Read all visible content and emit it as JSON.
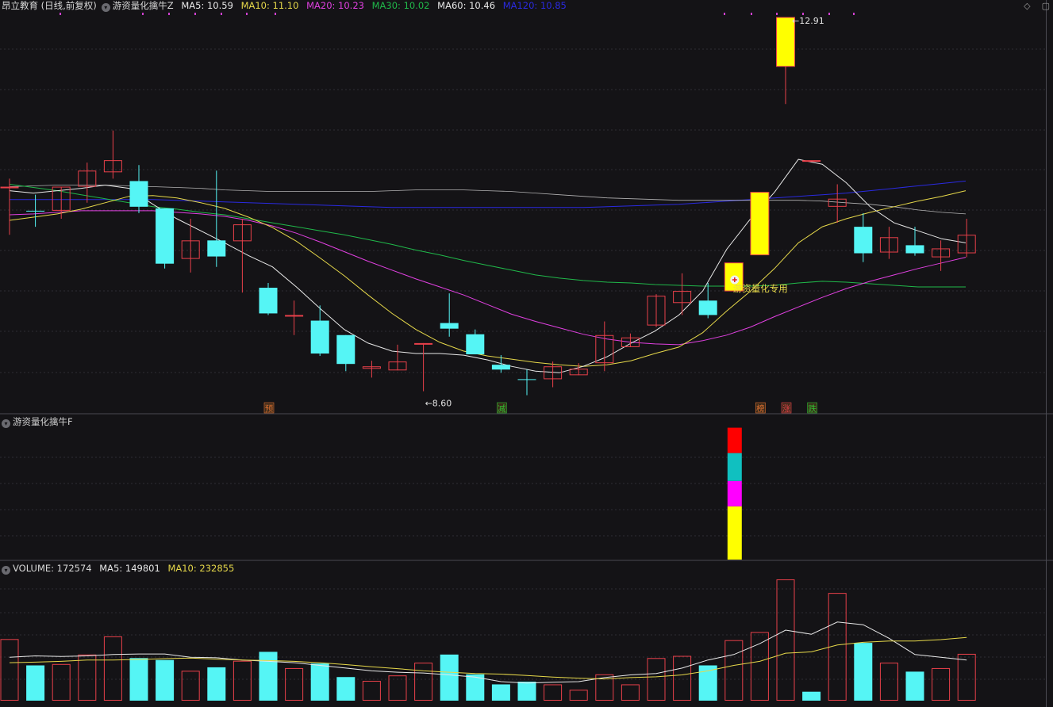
{
  "header": {
    "stock": "昂立教育 (日线,前复权)",
    "indicator": "游资量化擒牛Z",
    "ma": [
      {
        "label": "MA5: 10.59",
        "color": "#e8e8e8"
      },
      {
        "label": "MA10: 11.10",
        "color": "#e6d84a"
      },
      {
        "label": "MA20: 10.23",
        "color": "#e040e0"
      },
      {
        "label": "MA30: 10.02",
        "color": "#20b84a"
      },
      {
        "label": "MA60: 10.46",
        "color": "#e8e8e8"
      },
      {
        "label": "MA120: 10.85",
        "color": "#2a2ae0"
      }
    ]
  },
  "sub_panel_title": "游资量化擒牛F",
  "volume_header": {
    "volume": "VOLUME: 172574",
    "ma5": "MA5: 149801",
    "ma10": "MA10: 232855"
  },
  "colors": {
    "up": "#e8404a",
    "down": "#55f5f5",
    "limit_up": "#ffff00",
    "ma5": "#e8e8e8",
    "ma10": "#e6d84a",
    "ma20": "#e040e0",
    "ma30": "#20b84a",
    "ma60": "#e8e8e8",
    "ma120": "#2a2ae0"
  },
  "chart_data": [
    {
      "type": "candlestick",
      "title": "昂立教育 (日线,前复权)",
      "ylim": [
        8.0,
        13.0
      ],
      "annotations": {
        "high_label": "12.91",
        "low_label": "8.60",
        "signal_label": "游资量化专用",
        "markers": [
          {
            "text": "预",
            "index": 10,
            "color": "#e07030"
          },
          {
            "text": "减",
            "index": 19,
            "color": "#30c030"
          },
          {
            "text": "榜",
            "index": 29,
            "color": "#e07030"
          },
          {
            "text": "涨",
            "index": 30,
            "color": "#e8404a"
          },
          {
            "text": "跌",
            "index": 31,
            "color": "#30c030"
          }
        ]
      },
      "candles": [
        {
          "o": 10.8,
          "c": 10.8,
          "h": 10.9,
          "l": 10.2,
          "kind": "up"
        },
        {
          "o": 10.5,
          "c": 10.5,
          "h": 10.7,
          "l": 10.3,
          "kind": "down"
        },
        {
          "o": 10.5,
          "c": 10.8,
          "h": 10.8,
          "l": 10.4,
          "kind": "up"
        },
        {
          "o": 10.8,
          "c": 11.0,
          "h": 11.1,
          "l": 10.6,
          "kind": "up"
        },
        {
          "o": 10.98,
          "c": 11.13,
          "h": 11.5,
          "l": 10.9,
          "kind": "up"
        },
        {
          "o": 10.87,
          "c": 10.55,
          "h": 11.07,
          "l": 10.47,
          "kind": "down"
        },
        {
          "o": 10.53,
          "c": 9.84,
          "h": 10.53,
          "l": 9.78,
          "kind": "down"
        },
        {
          "o": 9.9,
          "c": 10.13,
          "h": 10.4,
          "l": 9.73,
          "kind": "up"
        },
        {
          "o": 10.13,
          "c": 9.93,
          "h": 11.0,
          "l": 9.8,
          "kind": "down"
        },
        {
          "o": 10.12,
          "c": 10.33,
          "h": 10.4,
          "l": 9.48,
          "kind": "up"
        },
        {
          "o": 9.54,
          "c": 9.22,
          "h": 9.6,
          "l": 9.2,
          "kind": "down"
        },
        {
          "o": 9.2,
          "c": 9.2,
          "h": 9.38,
          "l": 8.95,
          "kind": "up"
        },
        {
          "o": 9.13,
          "c": 8.72,
          "h": 9.32,
          "l": 8.69,
          "kind": "down"
        },
        {
          "o": 8.95,
          "c": 8.59,
          "h": 8.95,
          "l": 8.5,
          "kind": "down"
        },
        {
          "o": 8.53,
          "c": 8.56,
          "h": 8.63,
          "l": 8.42,
          "kind": "up"
        },
        {
          "o": 8.51,
          "c": 8.62,
          "h": 8.83,
          "l": 8.51,
          "kind": "up"
        },
        {
          "o": 8.85,
          "c": 8.85,
          "h": 8.85,
          "l": 8.25,
          "kind": "up"
        },
        {
          "o": 9.1,
          "c": 9.03,
          "h": 9.47,
          "l": 8.93,
          "kind": "down"
        },
        {
          "o": 8.96,
          "c": 8.71,
          "h": 9.02,
          "l": 8.71,
          "kind": "down"
        },
        {
          "o": 8.58,
          "c": 8.52,
          "h": 8.7,
          "l": 8.48,
          "kind": "down"
        },
        {
          "o": 8.4,
          "c": 8.4,
          "h": 8.52,
          "l": 8.2,
          "kind": "down"
        },
        {
          "o": 8.4,
          "c": 8.56,
          "h": 8.62,
          "l": 8.3,
          "kind": "up"
        },
        {
          "o": 8.45,
          "c": 8.53,
          "h": 8.6,
          "l": 8.45,
          "kind": "up"
        },
        {
          "o": 8.6,
          "c": 8.95,
          "h": 9.12,
          "l": 8.5,
          "kind": "up"
        },
        {
          "o": 8.8,
          "c": 8.92,
          "h": 8.97,
          "l": 8.8,
          "kind": "up"
        },
        {
          "o": 9.07,
          "c": 9.44,
          "h": 9.46,
          "l": 9.05,
          "kind": "up"
        },
        {
          "o": 9.35,
          "c": 9.5,
          "h": 9.72,
          "l": 9.2,
          "kind": "up"
        },
        {
          "o": 9.38,
          "c": 9.2,
          "h": 9.6,
          "l": 9.16,
          "kind": "down"
        },
        {
          "o": 9.5,
          "c": 9.85,
          "h": 9.85,
          "l": 9.5,
          "kind": "limit"
        },
        {
          "o": 9.95,
          "c": 10.73,
          "h": 10.73,
          "l": 9.95,
          "kind": "limit"
        },
        {
          "o": 12.3,
          "c": 12.91,
          "h": 12.91,
          "l": 11.83,
          "kind": "limit"
        },
        {
          "o": 11.13,
          "c": 11.13,
          "h": 11.13,
          "l": 11.13,
          "kind": "up"
        },
        {
          "o": 10.55,
          "c": 10.65,
          "h": 10.83,
          "l": 10.35,
          "kind": "up"
        },
        {
          "o": 10.3,
          "c": 9.97,
          "h": 10.47,
          "l": 9.86,
          "kind": "down"
        },
        {
          "o": 9.98,
          "c": 10.17,
          "h": 10.3,
          "l": 9.9,
          "kind": "up"
        },
        {
          "o": 10.07,
          "c": 9.97,
          "h": 10.3,
          "l": 9.94,
          "kind": "down"
        },
        {
          "o": 9.92,
          "c": 10.03,
          "h": 10.13,
          "l": 9.75,
          "kind": "up"
        },
        {
          "o": 9.97,
          "c": 10.2,
          "h": 10.4,
          "l": 9.92,
          "kind": "up"
        }
      ],
      "ma5": [
        10.75,
        10.72,
        10.75,
        10.78,
        10.82,
        10.78,
        10.58,
        10.4,
        10.25,
        10.1,
        9.94,
        9.8,
        9.55,
        9.28,
        9.02,
        8.85,
        8.75,
        8.72,
        8.72,
        8.7,
        8.64,
        8.56,
        8.5,
        8.48,
        8.56,
        8.68,
        8.85,
        9.0,
        9.2,
        9.5,
        10.02,
        10.4,
        10.73,
        11.14,
        11.08,
        10.85,
        10.55,
        10.35,
        10.25,
        10.15,
        10.1
      ],
      "ma10": [
        10.38,
        10.42,
        10.46,
        10.52,
        10.6,
        10.68,
        10.69,
        10.66,
        10.6,
        10.53,
        10.42,
        10.29,
        10.12,
        9.91,
        9.69,
        9.45,
        9.22,
        9.02,
        8.86,
        8.75,
        8.69,
        8.65,
        8.61,
        8.58,
        8.56,
        8.58,
        8.63,
        8.72,
        8.8,
        8.98,
        9.25,
        9.5,
        9.78,
        10.1,
        10.3,
        10.4,
        10.48,
        10.55,
        10.62,
        10.68,
        10.75
      ],
      "ma20": [
        10.45,
        10.46,
        10.48,
        10.5,
        10.5,
        10.5,
        10.5,
        10.48,
        10.46,
        10.43,
        10.38,
        10.31,
        10.22,
        10.11,
        9.99,
        9.87,
        9.76,
        9.65,
        9.55,
        9.45,
        9.33,
        9.21,
        9.12,
        9.04,
        8.96,
        8.9,
        8.86,
        8.84,
        8.83,
        8.88,
        8.95,
        9.05,
        9.18,
        9.3,
        9.42,
        9.53,
        9.62,
        9.7,
        9.78,
        9.85,
        9.92
      ],
      "ma30": [
        10.83,
        10.79,
        10.75,
        10.7,
        10.65,
        10.6,
        10.55,
        10.52,
        10.48,
        10.45,
        10.4,
        10.35,
        10.3,
        10.25,
        10.2,
        10.14,
        10.08,
        10.01,
        9.95,
        9.88,
        9.82,
        9.76,
        9.7,
        9.66,
        9.63,
        9.61,
        9.6,
        9.58,
        9.57,
        9.56,
        9.56,
        9.56,
        9.57,
        9.6,
        9.62,
        9.61,
        9.59,
        9.57,
        9.55,
        9.55,
        9.55
      ],
      "ma60": [
        10.8,
        10.81,
        10.82,
        10.82,
        10.82,
        10.81,
        10.8,
        10.79,
        10.78,
        10.76,
        10.75,
        10.74,
        10.74,
        10.74,
        10.74,
        10.74,
        10.75,
        10.76,
        10.76,
        10.76,
        10.75,
        10.74,
        10.72,
        10.7,
        10.68,
        10.66,
        10.65,
        10.64,
        10.63,
        10.63,
        10.63,
        10.63,
        10.63,
        10.63,
        10.62,
        10.6,
        10.58,
        10.55,
        10.51,
        10.48,
        10.46
      ],
      "ma120": [
        10.64,
        10.64,
        10.64,
        10.64,
        10.64,
        10.64,
        10.64,
        10.63,
        10.62,
        10.61,
        10.6,
        10.59,
        10.58,
        10.57,
        10.56,
        10.55,
        10.54,
        10.54,
        10.54,
        10.54,
        10.54,
        10.54,
        10.54,
        10.54,
        10.54,
        10.55,
        10.56,
        10.57,
        10.58,
        10.6,
        10.62,
        10.64,
        10.66,
        10.68,
        10.7,
        10.72,
        10.75,
        10.78,
        10.81,
        10.84,
        10.87
      ]
    },
    {
      "type": "bar",
      "title": "游资量化擒牛F",
      "signal_index": 28,
      "segments": [
        {
          "color": "#ff0000",
          "value": 1.0
        },
        {
          "color": "#10c0c0",
          "value": 1.1
        },
        {
          "color": "#ff00ff",
          "value": 1.0
        },
        {
          "color": "#ffff00",
          "value": 2.1
        }
      ]
    },
    {
      "type": "bar",
      "title": "VOLUME",
      "ylim": [
        0,
        450000
      ],
      "bars": [
        {
          "v": 227000,
          "kind": "up"
        },
        {
          "v": 130000,
          "kind": "down"
        },
        {
          "v": 135000,
          "kind": "up"
        },
        {
          "v": 170000,
          "kind": "up"
        },
        {
          "v": 237000,
          "kind": "up"
        },
        {
          "v": 157000,
          "kind": "down"
        },
        {
          "v": 150000,
          "kind": "down"
        },
        {
          "v": 110000,
          "kind": "up"
        },
        {
          "v": 123000,
          "kind": "down"
        },
        {
          "v": 147000,
          "kind": "up"
        },
        {
          "v": 180000,
          "kind": "down"
        },
        {
          "v": 120000,
          "kind": "up"
        },
        {
          "v": 137000,
          "kind": "down"
        },
        {
          "v": 87000,
          "kind": "down"
        },
        {
          "v": 73000,
          "kind": "up"
        },
        {
          "v": 93000,
          "kind": "up"
        },
        {
          "v": 140000,
          "kind": "up"
        },
        {
          "v": 170000,
          "kind": "down"
        },
        {
          "v": 97000,
          "kind": "down"
        },
        {
          "v": 60000,
          "kind": "down"
        },
        {
          "v": 70000,
          "kind": "down"
        },
        {
          "v": 60000,
          "kind": "up"
        },
        {
          "v": 40000,
          "kind": "up"
        },
        {
          "v": 97000,
          "kind": "up"
        },
        {
          "v": 60000,
          "kind": "up"
        },
        {
          "v": 157000,
          "kind": "up"
        },
        {
          "v": 165000,
          "kind": "up"
        },
        {
          "v": 130000,
          "kind": "down"
        },
        {
          "v": 223000,
          "kind": "up"
        },
        {
          "v": 253000,
          "kind": "up"
        },
        {
          "v": 447000,
          "kind": "up"
        },
        {
          "v": 33000,
          "kind": "down"
        },
        {
          "v": 397000,
          "kind": "up"
        },
        {
          "v": 213000,
          "kind": "down"
        },
        {
          "v": 140000,
          "kind": "up"
        },
        {
          "v": 107000,
          "kind": "down"
        },
        {
          "v": 120000,
          "kind": "up"
        },
        {
          "v": 172574,
          "kind": "up"
        }
      ],
      "ma5_line": [
        160000,
        165000,
        163000,
        165000,
        170000,
        172000,
        172000,
        160000,
        158000,
        150000,
        145000,
        140000,
        130000,
        120000,
        110000,
        105000,
        102000,
        95000,
        87000,
        70000,
        65000,
        68000,
        70000,
        85000,
        95000,
        100000,
        120000,
        150000,
        170000,
        210000,
        260000,
        245000,
        290000,
        280000,
        230000,
        170000,
        160000,
        149801
      ],
      "ma10_line": [
        140000,
        142000,
        145000,
        150000,
        150000,
        152000,
        155000,
        157000,
        153000,
        150000,
        148000,
        145000,
        140000,
        133000,
        125000,
        118000,
        110000,
        105000,
        100000,
        98000,
        93000,
        87000,
        83000,
        80000,
        85000,
        88000,
        95000,
        110000,
        130000,
        145000,
        175000,
        180000,
        205000,
        215000,
        220000,
        220000,
        225000,
        232855
      ]
    }
  ]
}
